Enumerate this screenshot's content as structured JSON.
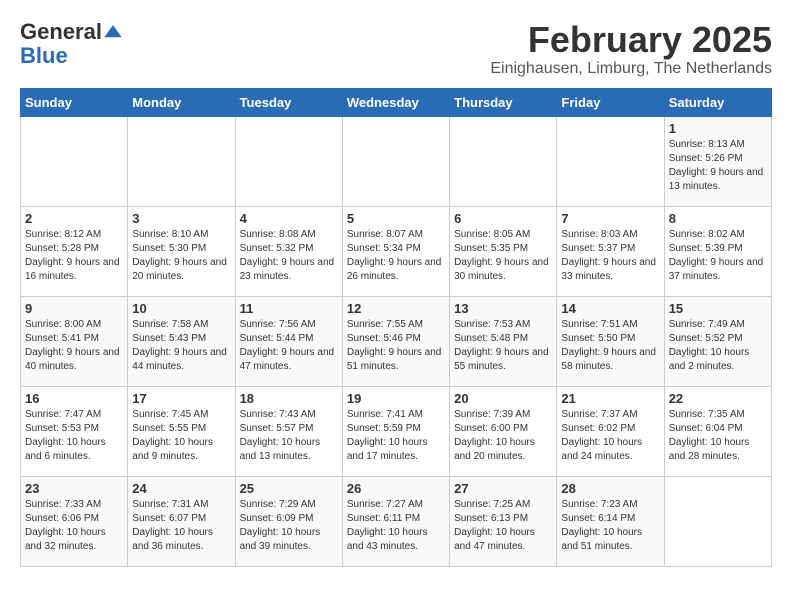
{
  "logo": {
    "general": "General",
    "blue": "Blue"
  },
  "header": {
    "title": "February 2025",
    "subtitle": "Einighausen, Limburg, The Netherlands"
  },
  "weekdays": [
    "Sunday",
    "Monday",
    "Tuesday",
    "Wednesday",
    "Thursday",
    "Friday",
    "Saturday"
  ],
  "weeks": [
    [
      {
        "day": "",
        "info": ""
      },
      {
        "day": "",
        "info": ""
      },
      {
        "day": "",
        "info": ""
      },
      {
        "day": "",
        "info": ""
      },
      {
        "day": "",
        "info": ""
      },
      {
        "day": "",
        "info": ""
      },
      {
        "day": "1",
        "info": "Sunrise: 8:13 AM\nSunset: 5:26 PM\nDaylight: 9 hours and 13 minutes."
      }
    ],
    [
      {
        "day": "2",
        "info": "Sunrise: 8:12 AM\nSunset: 5:28 PM\nDaylight: 9 hours and 16 minutes."
      },
      {
        "day": "3",
        "info": "Sunrise: 8:10 AM\nSunset: 5:30 PM\nDaylight: 9 hours and 20 minutes."
      },
      {
        "day": "4",
        "info": "Sunrise: 8:08 AM\nSunset: 5:32 PM\nDaylight: 9 hours and 23 minutes."
      },
      {
        "day": "5",
        "info": "Sunrise: 8:07 AM\nSunset: 5:34 PM\nDaylight: 9 hours and 26 minutes."
      },
      {
        "day": "6",
        "info": "Sunrise: 8:05 AM\nSunset: 5:35 PM\nDaylight: 9 hours and 30 minutes."
      },
      {
        "day": "7",
        "info": "Sunrise: 8:03 AM\nSunset: 5:37 PM\nDaylight: 9 hours and 33 minutes."
      },
      {
        "day": "8",
        "info": "Sunrise: 8:02 AM\nSunset: 5:39 PM\nDaylight: 9 hours and 37 minutes."
      }
    ],
    [
      {
        "day": "9",
        "info": "Sunrise: 8:00 AM\nSunset: 5:41 PM\nDaylight: 9 hours and 40 minutes."
      },
      {
        "day": "10",
        "info": "Sunrise: 7:58 AM\nSunset: 5:43 PM\nDaylight: 9 hours and 44 minutes."
      },
      {
        "day": "11",
        "info": "Sunrise: 7:56 AM\nSunset: 5:44 PM\nDaylight: 9 hours and 47 minutes."
      },
      {
        "day": "12",
        "info": "Sunrise: 7:55 AM\nSunset: 5:46 PM\nDaylight: 9 hours and 51 minutes."
      },
      {
        "day": "13",
        "info": "Sunrise: 7:53 AM\nSunset: 5:48 PM\nDaylight: 9 hours and 55 minutes."
      },
      {
        "day": "14",
        "info": "Sunrise: 7:51 AM\nSunset: 5:50 PM\nDaylight: 9 hours and 58 minutes."
      },
      {
        "day": "15",
        "info": "Sunrise: 7:49 AM\nSunset: 5:52 PM\nDaylight: 10 hours and 2 minutes."
      }
    ],
    [
      {
        "day": "16",
        "info": "Sunrise: 7:47 AM\nSunset: 5:53 PM\nDaylight: 10 hours and 6 minutes."
      },
      {
        "day": "17",
        "info": "Sunrise: 7:45 AM\nSunset: 5:55 PM\nDaylight: 10 hours and 9 minutes."
      },
      {
        "day": "18",
        "info": "Sunrise: 7:43 AM\nSunset: 5:57 PM\nDaylight: 10 hours and 13 minutes."
      },
      {
        "day": "19",
        "info": "Sunrise: 7:41 AM\nSunset: 5:59 PM\nDaylight: 10 hours and 17 minutes."
      },
      {
        "day": "20",
        "info": "Sunrise: 7:39 AM\nSunset: 6:00 PM\nDaylight: 10 hours and 20 minutes."
      },
      {
        "day": "21",
        "info": "Sunrise: 7:37 AM\nSunset: 6:02 PM\nDaylight: 10 hours and 24 minutes."
      },
      {
        "day": "22",
        "info": "Sunrise: 7:35 AM\nSunset: 6:04 PM\nDaylight: 10 hours and 28 minutes."
      }
    ],
    [
      {
        "day": "23",
        "info": "Sunrise: 7:33 AM\nSunset: 6:06 PM\nDaylight: 10 hours and 32 minutes."
      },
      {
        "day": "24",
        "info": "Sunrise: 7:31 AM\nSunset: 6:07 PM\nDaylight: 10 hours and 36 minutes."
      },
      {
        "day": "25",
        "info": "Sunrise: 7:29 AM\nSunset: 6:09 PM\nDaylight: 10 hours and 39 minutes."
      },
      {
        "day": "26",
        "info": "Sunrise: 7:27 AM\nSunset: 6:11 PM\nDaylight: 10 hours and 43 minutes."
      },
      {
        "day": "27",
        "info": "Sunrise: 7:25 AM\nSunset: 6:13 PM\nDaylight: 10 hours and 47 minutes."
      },
      {
        "day": "28",
        "info": "Sunrise: 7:23 AM\nSunset: 6:14 PM\nDaylight: 10 hours and 51 minutes."
      },
      {
        "day": "",
        "info": ""
      }
    ]
  ]
}
